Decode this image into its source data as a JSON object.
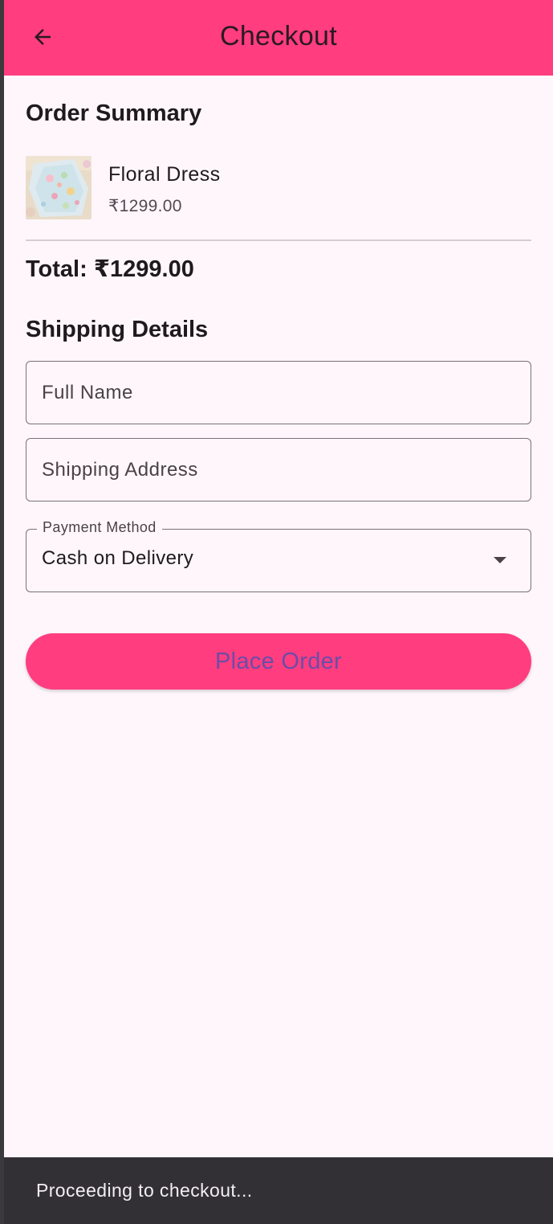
{
  "app_bar": {
    "title": "Checkout",
    "back_icon": "arrow-back-icon",
    "color": "#ff3d7f"
  },
  "order_summary": {
    "heading": "Order Summary",
    "items": [
      {
        "name": "Floral Dress",
        "price": "₹1299.00",
        "image": "floral-dress-thumbnail"
      }
    ],
    "total": "Total: ₹1299.00"
  },
  "shipping": {
    "heading": "Shipping Details",
    "full_name": {
      "placeholder": "Full Name",
      "value": ""
    },
    "address": {
      "placeholder": "Shipping Address",
      "value": ""
    },
    "payment": {
      "label": "Payment Method",
      "selected": "Cash on Delivery",
      "icon": "dropdown-arrow-icon"
    }
  },
  "place_order": {
    "label": "Place Order"
  },
  "snackbar": {
    "message": "Proceeding to checkout..."
  }
}
